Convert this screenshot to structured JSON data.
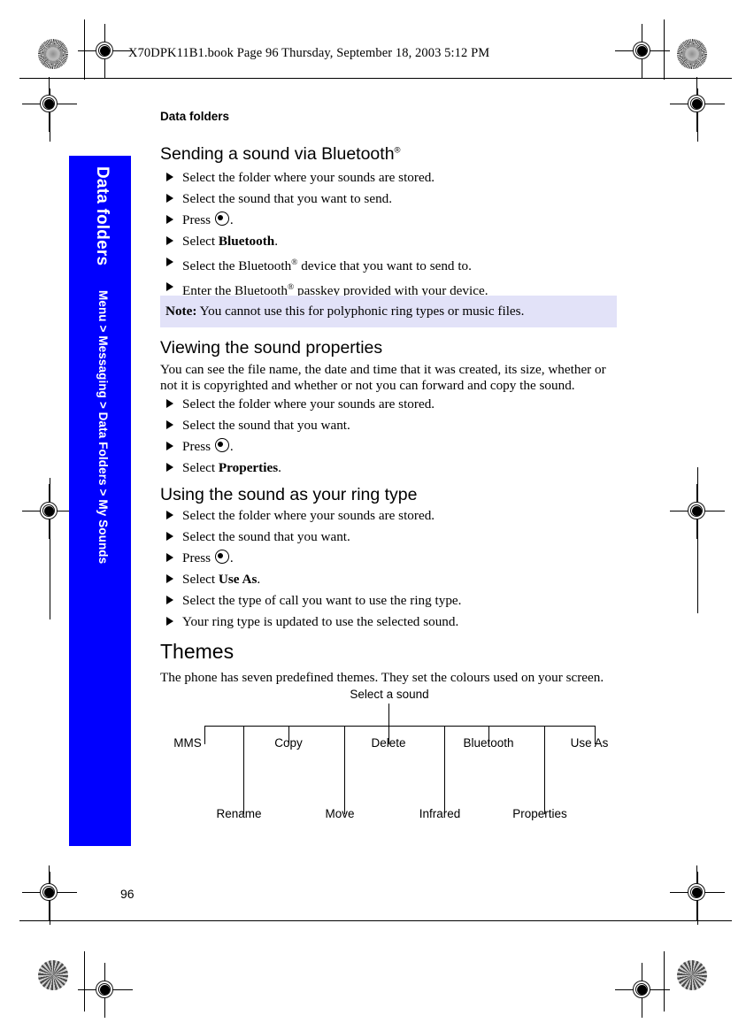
{
  "header": {
    "book_line": "X70DPK11B1.book  Page 96  Thursday, September 18, 2003  5:12 PM"
  },
  "running_head": "Data folders",
  "side_tab": {
    "title": "Data folders",
    "breadcrumb": "Menu > Messaging > Data Folders > My Sounds",
    "color": "#0000FF"
  },
  "sections": [
    {
      "heading": "Sending a sound via Bluetooth",
      "heading_sup": "®",
      "steps": [
        "Select the folder where your sounds are stored.",
        "Select the sound that you want to send.",
        "Press",
        "Select Bluetooth.",
        "Select the Bluetooth® device that you want to send to.",
        "Enter the Bluetooth® passkey provided with your device."
      ]
    },
    {
      "heading": "Viewing the sound properties",
      "body": "You can see the file name, the date and time that it was created, its size, whether or not it is copyrighted and whether or not you can forward and copy the sound.",
      "steps": [
        "Select the folder where your sounds are stored.",
        "Select the sound that you want.",
        "Press",
        "Select Properties."
      ]
    },
    {
      "heading": "Using the sound as your ring type",
      "steps": [
        "Select the folder where your sounds are stored.",
        "Select the sound that you want.",
        "Press",
        "Select Use As.",
        "Select the type of call you want to use the ring type.",
        "Your ring type is updated to use the selected sound."
      ]
    },
    {
      "heading": "Themes",
      "body": "The phone has seven predefined themes. They set the colours used on your screen."
    }
  ],
  "note": {
    "label": "Note:",
    "text": "You cannot use this for polyphonic ring types or music files.",
    "background": "#E2E2F8"
  },
  "step_labels": {
    "press": "Press",
    "select": "Select",
    "period": ".",
    "bluetooth_bold": "Bluetooth",
    "properties_bold": "Properties",
    "use_as_bold": "Use As",
    "select_bt_device_pre": "Select the Bluetooth",
    "select_bt_device_post": " device that you want to send to.",
    "enter_bt_pre": "Enter the Bluetooth",
    "enter_bt_post": " passkey provided with your device.",
    "reg": "®"
  },
  "tree_diagram": {
    "root": "Select a sound",
    "upper_labels": [
      "MMS",
      "Copy",
      "Delete",
      "Bluetooth",
      "Use As"
    ],
    "lower_labels": [
      "Rename",
      "Move",
      "Infrared",
      "Properties"
    ]
  },
  "footer": {
    "page_number": "96"
  }
}
